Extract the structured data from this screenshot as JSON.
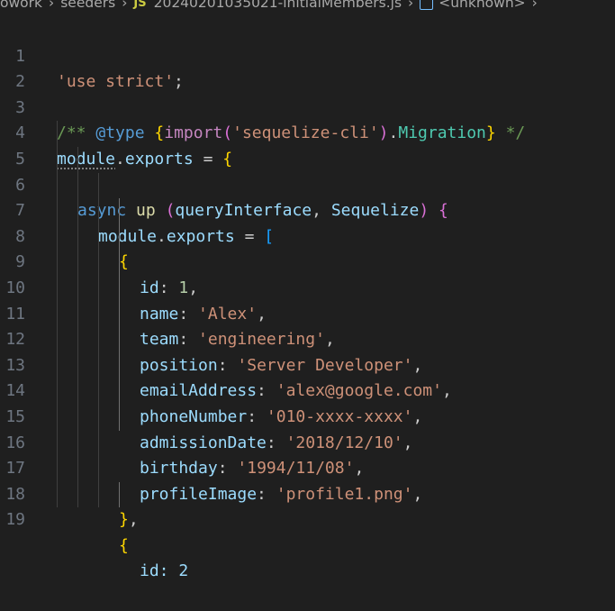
{
  "breadcrumb": {
    "parts": [
      "owork",
      "seeders",
      "20240201035021-initialMembers.js",
      "<unknown>"
    ],
    "file_badge": "JS"
  },
  "code": {
    "line_numbers": [
      "1",
      "2",
      "3",
      "4",
      "5",
      "6",
      "7",
      "8",
      "9",
      "10",
      "11",
      "12",
      "13",
      "14",
      "15",
      "16",
      "17",
      "18",
      "19"
    ],
    "line1": "'use strict'",
    "line3_comment_open": "/**",
    "line3_tag": "@type",
    "line3_import": "import",
    "line3_module": "'sequelize-cli'",
    "line3_type": "Migration",
    "line3_comment_close": "*/",
    "module_kw": "module",
    "exports_kw": "exports",
    "async_kw": "async",
    "up_fn": "up",
    "param1": "queryInterface",
    "param2": "Sequelize",
    "records": [
      {
        "id": "1",
        "name": "'Alex'",
        "team": "'engineering'",
        "position": "'Server Developer'",
        "emailAddress": "'alex@google.com'",
        "phoneNumber": "'010-xxxx-xxxx'",
        "admissionDate": "'2018/12/10'",
        "birthday": "'1994/11/08'",
        "profileImage": "'profile1.png'"
      }
    ],
    "keys": {
      "id": "id",
      "name": "name",
      "team": "team",
      "position": "position",
      "emailAddress": "emailAddress",
      "phoneNumber": "phoneNumber",
      "admissionDate": "admissionDate",
      "birthday": "birthday",
      "profileImage": "profileImage"
    },
    "line19_partial": "id: 2"
  },
  "colors": {
    "background": "#1f1f1f",
    "string": "#ce9178",
    "comment": "#6a9955",
    "keyword": "#569cd6",
    "variable": "#9cdcfe",
    "bracket_level1": "#ffd700",
    "bracket_level2": "#da70d6",
    "bracket_level3": "#179fff"
  }
}
